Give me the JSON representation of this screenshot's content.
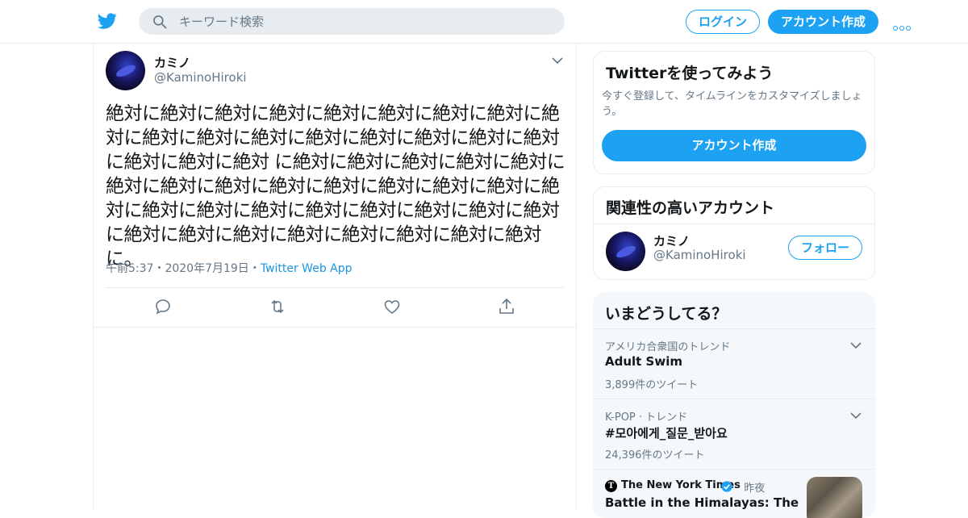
{
  "header": {
    "search_placeholder": "キーワード検索",
    "login_label": "ログイン",
    "signup_label": "アカウント作成"
  },
  "tweet": {
    "author_name": "カミノ",
    "author_handle": "@KaminoHiroki",
    "text": "絶対に絶対に絶対に絶対に絶対に絶対に絶対に絶対に絶対に絶対に絶対に絶対に絶対に絶対に絶対に絶対に絶対に絶対に絶対に絶対 に絶対に絶対に絶対に絶対に絶対に絶対に絶対に絶対に絶対に絶対に絶対に絶対に絶対に絶対に絶対に絶対に絶対に絶対に絶対に絶対に絶対に絶対に絶対に絶対に絶対に絶対に絶対に絶対に絶対に絶対に。",
    "time": "午前5:37",
    "date": "2020年7月19日",
    "source": "Twitter Web App",
    "separator": "・"
  },
  "signup_card": {
    "title": "Twitterを使ってみよう",
    "description": "今すぐ登録して、タイムラインをカスタマイズしましょう。",
    "button_label": "アカウント作成"
  },
  "related": {
    "title": "関連性の高いアカウント",
    "name": "カミノ",
    "handle": "@KaminoHiroki",
    "follow_label": "フォロー"
  },
  "trends": {
    "title": "いまどうしてる？",
    "items": [
      {
        "context": "アメリカ合衆国のトレンド",
        "name": "Adult Swim",
        "count": "3,899件のツイート"
      },
      {
        "context": "K-POP · トレンド",
        "name": "#모아에게_질문_받아요",
        "count": "24,396件のツイート"
      }
    ],
    "news": {
      "source": "The New York Times",
      "logo_letter": "T",
      "time": "· 昨夜",
      "title": "Battle in the Himalayas: The"
    }
  },
  "colors": {
    "brand": "#1da1f2",
    "link": "#1b95e0",
    "muted": "#657786",
    "text": "#14171a"
  },
  "icons": [
    "twitter-bird-icon",
    "search-icon",
    "more-icon",
    "chevron-down-icon",
    "reply-icon",
    "retweet-icon",
    "like-icon",
    "share-icon",
    "verified-icon"
  ]
}
